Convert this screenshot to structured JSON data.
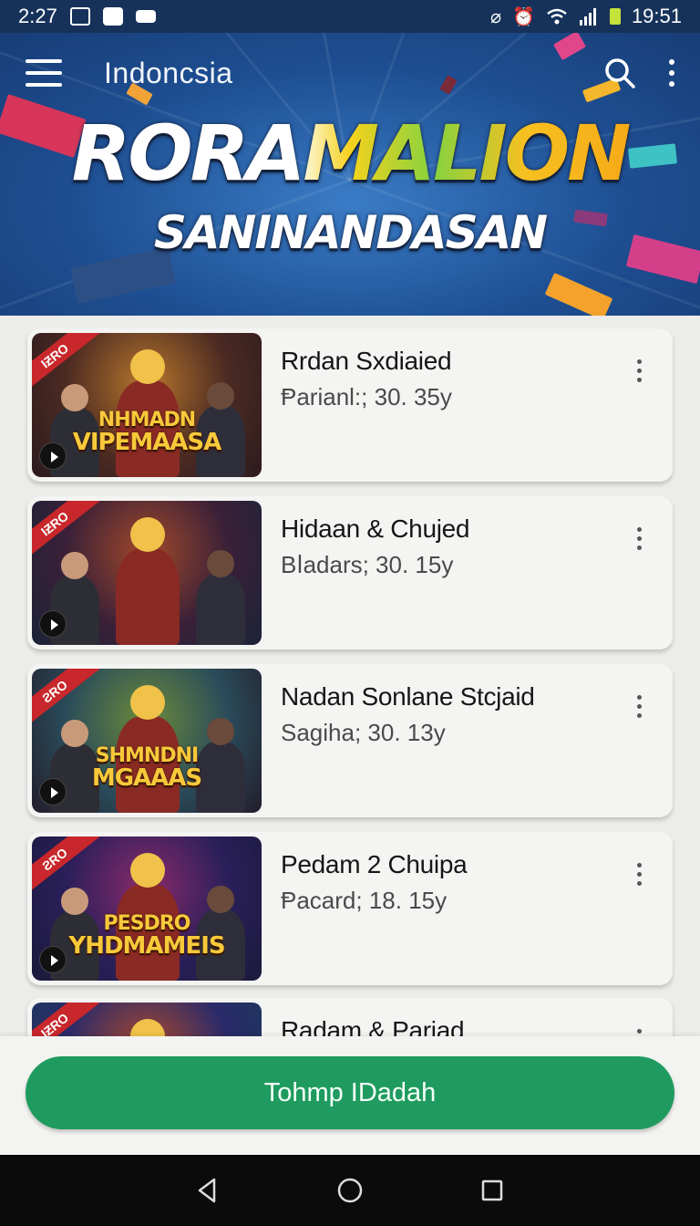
{
  "status_bar": {
    "time_left": "2:27",
    "time_right": "19:51",
    "left_icons": [
      "gallery-icon",
      "message-icon",
      "chat-icon"
    ],
    "right_icons": [
      "mute-icon",
      "alarm-icon",
      "wifi-icon",
      "signal-icon",
      "battery-icon"
    ]
  },
  "appbar": {
    "title": "Indoncsia",
    "icons": [
      "menu-icon",
      "search-icon",
      "more-vert-icon"
    ]
  },
  "banner": {
    "headline": "RORAMALION",
    "subheadline": "SANINANDASAN"
  },
  "items": [
    {
      "title": "Rrdan Sxdiaied",
      "subtitle": "Ᵽarianl:; 30. 35y",
      "badge": "IƵRO",
      "thumb_caption_line1": "NHMADN",
      "thumb_caption_line2": "VIPEMAASA",
      "thumb_palette": [
        "#4b2a22",
        "#b8762c",
        "#2c1a1e"
      ]
    },
    {
      "title": "Hidaan & Chujed",
      "subtitle": "Bⅼadars;  30. 15y",
      "badge": "IƵRO",
      "thumb_caption_line1": "",
      "thumb_caption_line2": "",
      "thumb_palette": [
        "#3a2038",
        "#a2492a",
        "#1b2338"
      ]
    },
    {
      "title": "Nadan Sonlane Stcjaid",
      "subtitle": "Sagiha;  30. 13y",
      "badge": "ƧRO",
      "thumb_caption_line1": "SHMNDNI",
      "thumb_caption_line2": "MGAAAS",
      "thumb_palette": [
        "#2a4b5a",
        "#6a8a3a",
        "#231c2a"
      ]
    },
    {
      "title": "Pedam 2 Chuipa",
      "subtitle": "Ᵽacard;  18. 15y",
      "badge": "ƧRO",
      "thumb_caption_line1": "PESDRO",
      "thumb_caption_line2": "YHDMAMEIS",
      "thumb_palette": [
        "#2a1f5a",
        "#8a2a6a",
        "#1a1a3a"
      ]
    },
    {
      "title": "Radam & Pariad",
      "subtitle": "",
      "badge": "IƵRO",
      "thumb_caption_line1": "",
      "thumb_caption_line2": "",
      "thumb_palette": [
        "#2a2a6a",
        "#b04a2a",
        "#1a3a5a"
      ]
    }
  ],
  "bottom_button": {
    "label": "Tohmp IDadah",
    "color": "#1f9b5f"
  },
  "nav_bar": {
    "icons": [
      "back-icon",
      "home-icon",
      "recents-icon"
    ]
  }
}
